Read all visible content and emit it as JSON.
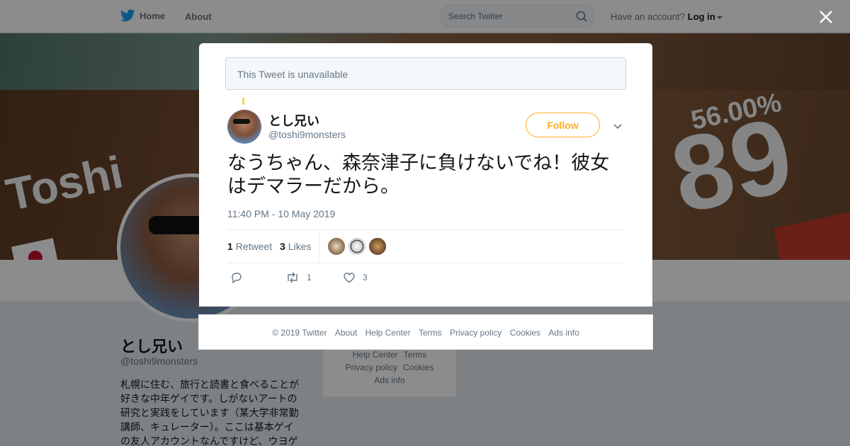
{
  "topbar": {
    "home_label": "Home",
    "about_label": "About",
    "search_placeholder": "Search Twitter",
    "account_prompt": "Have an account?",
    "login_label": "Log in"
  },
  "banner": {
    "text_name": "Toshi",
    "text_country": "Ja",
    "text_number": "89",
    "text_percent": "56.00%"
  },
  "profile": {
    "name": "とし兄い",
    "handle": "@toshi9monsters",
    "bio": "札幌に住む、旅行と読書と食べることが好きな中年ゲイです。しがないアートの研究と実践をしています（某大学非常勤講師、キュレーター）。ここは基本ゲイの友人アカウントなんですけど、ウヨゲ"
  },
  "bg_footer": {
    "links": [
      "Help Center",
      "Terms",
      "Privacy policy",
      "Cookies",
      "Ads info"
    ]
  },
  "modal": {
    "unavailable": "This Tweet is unavailable",
    "tweet": {
      "name": "とし兄い",
      "handle": "@toshi9monsters",
      "follow_label": "Follow",
      "text": "なうちゃん、森奈津子に負けないでね！彼女はデマラーだから。",
      "time": "11:40 PM - 10 May 2019",
      "retweet_count": "1",
      "retweet_label": "Retweet",
      "like_count": "3",
      "like_label": "Likes",
      "action_retweet_count": "1",
      "action_like_count": "3"
    }
  },
  "footer": {
    "copyright": "© 2019 Twitter",
    "about": "About",
    "help": "Help Center",
    "terms": "Terms",
    "privacy": "Privacy policy",
    "cookies": "Cookies",
    "ads": "Ads info"
  },
  "colors": {
    "accent": "#ffad1f",
    "twitter_blue": "#1da1f2",
    "text_secondary": "#657786"
  },
  "icons": [
    "twitter-bird-icon",
    "search-icon",
    "close-icon",
    "chevron-down-icon",
    "reply-icon",
    "retweet-icon",
    "heart-icon"
  ]
}
